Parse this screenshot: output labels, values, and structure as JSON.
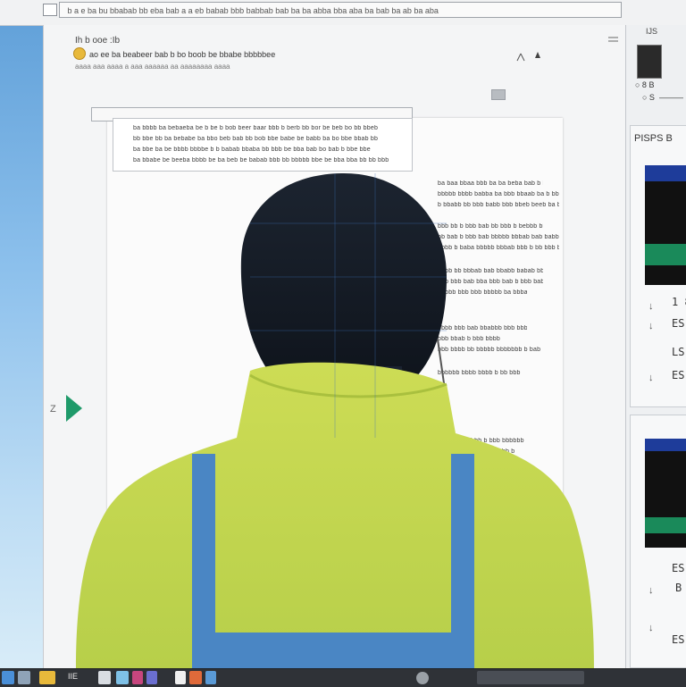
{
  "top_bar": {
    "url_text": " b a e ba bu bbabab bb eba bab a a eb babab bbb babbab bab ba ba abba bba aba ba bab ba ab ba aba"
  },
  "header": {
    "title": "Ih b ooe :Ib",
    "subtitle": "ao ee ba beabeer bab b bo boob be bbabe bbbbbee",
    "meta": "aaaa aaa aaaa a aaa aaaaaa aa aaaaaaaa aaaa"
  },
  "toolbar_icons": {
    "expand": "arrow-up-icon",
    "resize": "resize-icon"
  },
  "doc": {
    "snippet_lines": [
      "ba bbbb ba bebaeba be b be b bob beer baar bbb b berb bb bor be beb bo bb bbeb",
      "bb bbe bb ba bebabe ba bbo beb bab bb bob bbe babe be babb ba bo bbe bbab bb",
      "ba bbe ba be bbbb bbbbe b b babab bbaba bb bbb be bba bab bo bab b bbe bbe",
      "ba bbabe be beeba bbbb be ba beb be babab bbb bb bbbbb bbe be bba bba bb bb bbb"
    ],
    "right_lines": [
      "ba baa bbaa bbb ba ba beba bab b beb bbab ba b",
      "bbbbb bbbb babba ba bbb bbaab ba b bbb bbb bba",
      "b bbabb bb bbb babb bbb bbeb beeb ba bbb bbbb",
      "bbb bb b bbb bab bb bbb b bebbb bbab beb bbab b",
      "bb bab b bbb bab bbbbb bbbab bab babb bbbbbb",
      "bbbb b baba bbbbb bbbab bbb b bb bbb bbbb bbb",
      "bbbb bb bbbab bab bbabb babab bbb bbbbbb",
      "bbb bbb bab bba bbb bab b bbb bab b bbbbbb",
      "bbbbb bbb bbb bbbbb ba bbbab bb bbb",
      "bbbb bbb bab bbabbb bbb bbbbbbbb",
      "bbb bbab b bbb bbbb",
      "bbb bbbb bb bbbbb bbbbbbb b bab",
      "bbbbbb bbbb bbbb b bb bbb",
      "bbbb bbbb bbb b bbb bbbbbb",
      "bbbbbb bbbbbb bbbb bb b",
      "bbbbb bbbb bbbb bb bbbbbb"
    ]
  },
  "right_panel": {
    "top_label": "IJS",
    "top_value": "○ 8 B",
    "top_footer": "○ S  ———",
    "card1_title": "PISPS B",
    "card1_values": [
      "1 8",
      "ES",
      "LS",
      "ES"
    ],
    "card2_values": [
      "ES",
      "B",
      "ES"
    ]
  },
  "taskbar": {
    "label": "IIE"
  },
  "colors": {
    "taskbar": "#2f3237",
    "chart_blue": "#1e3c9a",
    "chart_green": "#1a8a5a",
    "chart_dark": "#111111",
    "accent_green": "#1f9a6a"
  }
}
